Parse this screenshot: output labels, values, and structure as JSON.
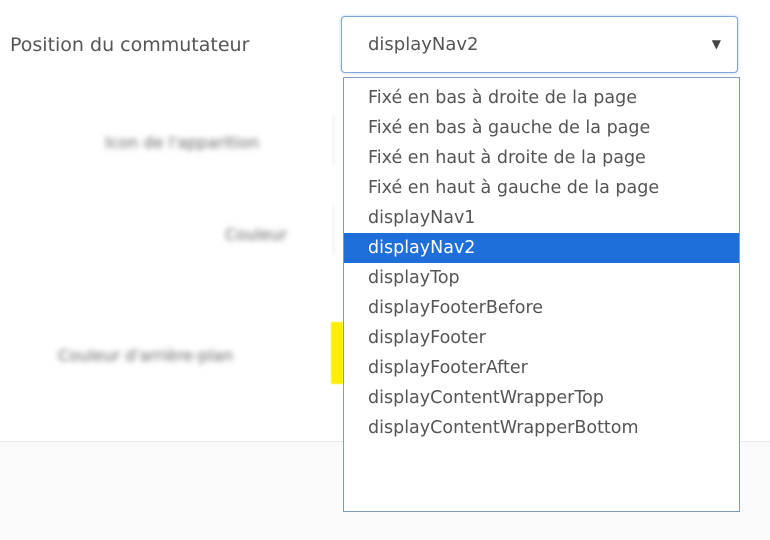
{
  "field": {
    "label": "Position du commutateur",
    "selected_value": "displayNav2",
    "arrow": "▼"
  },
  "background_rows": [
    {
      "label": "Icon de l'apparition"
    },
    {
      "label": "Couleur"
    },
    {
      "label": "Couleur d'arrière-plan"
    }
  ],
  "dropdown": {
    "options": [
      {
        "label": "Fixé en bas à droite de la page"
      },
      {
        "label": "Fixé en bas à gauche de la page"
      },
      {
        "label": "Fixé en haut à droite de la page"
      },
      {
        "label": "Fixé en haut à gauche de la page"
      },
      {
        "label": "displayNav1"
      },
      {
        "label": "displayNav2"
      },
      {
        "label": "displayTop"
      },
      {
        "label": "displayFooterBefore"
      },
      {
        "label": "displayFooter"
      },
      {
        "label": "displayFooterAfter"
      },
      {
        "label": "displayContentWrapperTop"
      },
      {
        "label": "displayContentWrapperBottom"
      }
    ],
    "selected_index": 5
  },
  "colors": {
    "highlight": "#1e6fd9",
    "swatch": "#ffee00",
    "focus_border": "#7fa6d6"
  }
}
